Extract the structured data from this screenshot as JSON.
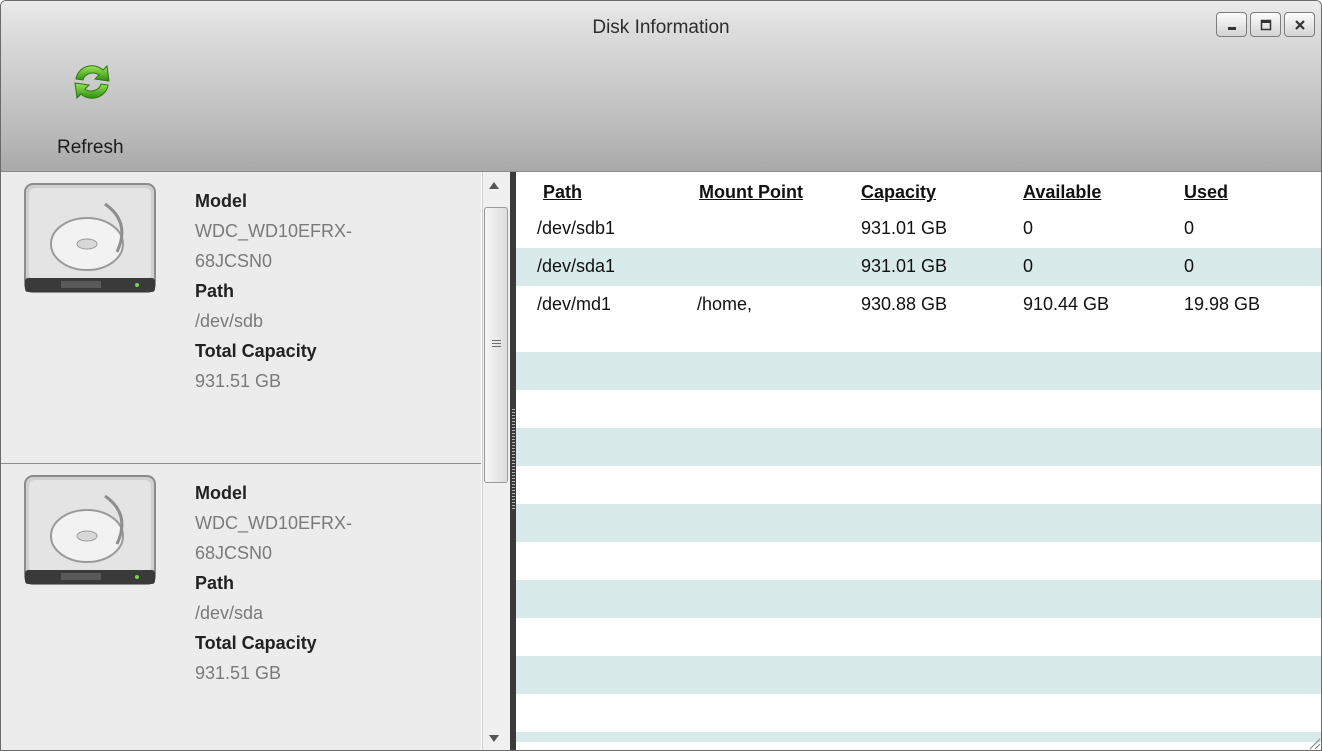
{
  "window": {
    "title": "Disk Information",
    "buttons": [
      "minimize",
      "maximize",
      "close"
    ]
  },
  "toolbar": {
    "refresh_label": "Refresh",
    "refresh_icon": "refresh-icon"
  },
  "disks": [
    {
      "model_label": "Model",
      "model_line1": "WDC_WD10EFRX-",
      "model_line2": "68JCSN0",
      "path_label": "Path",
      "path": "/dev/sdb",
      "capacity_label": "Total Capacity",
      "capacity": "931.51 GB"
    },
    {
      "model_label": "Model",
      "model_line1": "WDC_WD10EFRX-",
      "model_line2": "68JCSN0",
      "path_label": "Path",
      "path": "/dev/sda",
      "capacity_label": "Total Capacity",
      "capacity": "931.51 GB"
    }
  ],
  "table": {
    "columns": [
      "Path",
      "Mount Point",
      "Capacity",
      "Available",
      "Used"
    ],
    "rows": [
      [
        "/dev/sdb1",
        "",
        "931.01 GB",
        "0",
        "0"
      ],
      [
        "/dev/sda1",
        "",
        "931.01 GB",
        "0",
        "0"
      ],
      [
        "/dev/md1",
        "/home,",
        "930.88 GB",
        "910.44 GB",
        "19.98 GB"
      ]
    ]
  },
  "colors": {
    "row_stripe": "#d8eaea",
    "toolbar_top": "#ececec",
    "toolbar_bottom": "#a9a9a9",
    "refresh_green": "#4caf1f"
  }
}
